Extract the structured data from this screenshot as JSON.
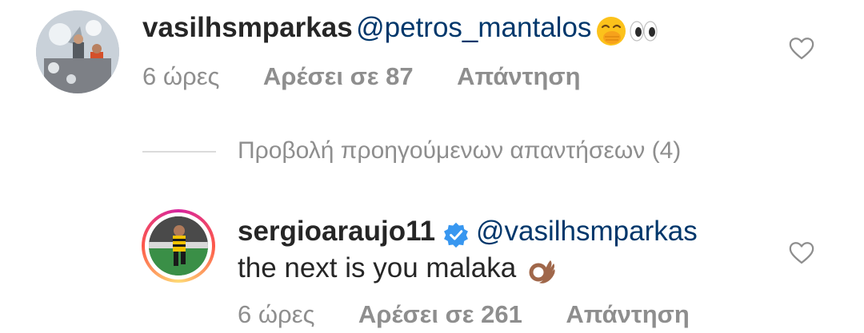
{
  "comment": {
    "username": "vasilhsmparkas",
    "mention": "@petros_mantalos",
    "emojis": [
      "face-with-hand-over-mouth-emoji",
      "eyes-emoji"
    ],
    "time": "6 ώρες",
    "likes": "Αρέσει σε 87",
    "reply": "Απάντηση"
  },
  "view_previous_replies": "Προβολή προηγούμενων απαντήσεων (4)",
  "reply_comment": {
    "username": "sergioaraujo11",
    "verified": true,
    "mention": "@vasilhsmparkas",
    "text": "the next is you malaka",
    "emoji": "ok-hand-medium-dark-skin-emoji",
    "time": "6 ώρες",
    "likes": "Αρέσει σε 261",
    "reply": "Απάντηση"
  },
  "colors": {
    "text": "#262626",
    "mention": "#00376b",
    "meta": "#8e8e8e",
    "verified": "#3897f0",
    "divider": "#dbdbdb"
  }
}
